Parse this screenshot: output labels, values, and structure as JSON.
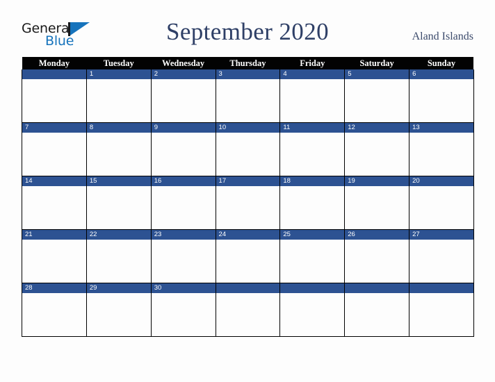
{
  "brand": {
    "name_part1": "General",
    "name_part2": "Blue",
    "triangle_icon": "triangle-icon",
    "accent_blue": "#1673bc",
    "dark": "#1a1a1a"
  },
  "header": {
    "month_title": "September 2020",
    "country": "Aland Islands",
    "title_color": "#2e3f66"
  },
  "calendar": {
    "weekday_headers": [
      "Monday",
      "Tuesday",
      "Wednesday",
      "Thursday",
      "Friday",
      "Saturday",
      "Sunday"
    ],
    "header_bg": "#030303",
    "header_text": "#ffffff",
    "daynum_bg": "#2d5292",
    "daynum_text": "#ffffff",
    "cell_bg": "#fdfdfd",
    "grid_line": "#000000",
    "weeks": [
      [
        "",
        "1",
        "2",
        "3",
        "4",
        "5",
        "6"
      ],
      [
        "7",
        "8",
        "9",
        "10",
        "11",
        "12",
        "13"
      ],
      [
        "14",
        "15",
        "16",
        "17",
        "18",
        "19",
        "20"
      ],
      [
        "21",
        "22",
        "23",
        "24",
        "25",
        "26",
        "27"
      ],
      [
        "28",
        "29",
        "30",
        "",
        "",
        "",
        ""
      ]
    ]
  }
}
